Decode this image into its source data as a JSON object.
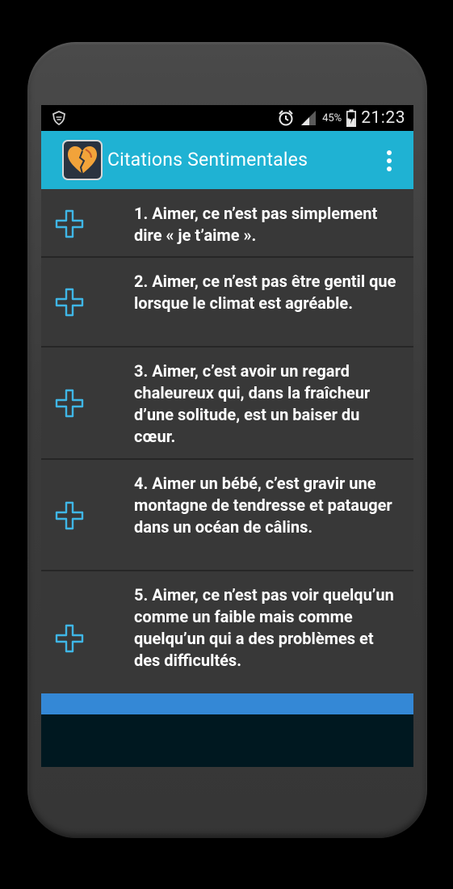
{
  "status": {
    "battery_percent": "45%",
    "time": "21:23"
  },
  "app": {
    "title": "Citations Sentimentales"
  },
  "quotes": [
    "1. Aimer, ce n’est pas simplement dire « je t’aime ».",
    "2. Aimer, ce n’est pas être gentil que lorsque le climat est agréable.",
    "3. Aimer, c’est avoir un regard chaleureux qui, dans la fraîcheur d’une solitude, est un baiser du cœur.",
    "4. Aimer un bébé, c’est gravir une montagne de tendresse et patauger dans un océan de câlins.",
    "5. Aimer, ce n’est pas voir quelqu’un comme un faible mais comme quelqu’un qui a des problèmes et des difficultés."
  ],
  "colors": {
    "appbar": "#1fb2d3",
    "plus_icon": "#3fb6e6",
    "bottom_bar": "#3488d6"
  },
  "icons": {
    "status_left": "shield-icon",
    "alarm": "alarm-clock-icon",
    "signal": "signal-icon",
    "battery": "battery-charging-icon",
    "overflow": "more-vert-icon",
    "row": "plus-icon"
  }
}
